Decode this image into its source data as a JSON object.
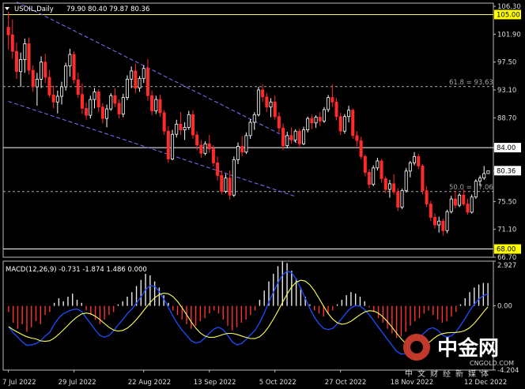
{
  "chart_data": {
    "type": "candlestick",
    "symbol": "USOIL,Daily",
    "header": {
      "symbol_label": "USOIL,Daily",
      "ohlc_text": "79.90 80.40 79.87 80.36"
    },
    "price_axis": {
      "range": [
        66.7,
        106.8
      ],
      "ticks": [
        "106.30",
        "101.90",
        "97.50",
        "93.10",
        "88.70",
        "84.00",
        "80.36",
        "75.50",
        "71.10",
        "66.70"
      ],
      "highlight_labels": [
        {
          "text": "105.00",
          "value": 105.0,
          "bg": "#ffff00"
        },
        {
          "text": "84.00",
          "value": 84.0,
          "bg": "#ffffff"
        },
        {
          "text": "80.36",
          "value": 80.36,
          "bg": "#ffffff"
        },
        {
          "text": "68.00",
          "value": 68.0,
          "bg": "#ffff00"
        }
      ]
    },
    "horizontal_lines": [
      {
        "value": 105.0,
        "color": "#ffff66",
        "style": "solid"
      },
      {
        "value": 84.0,
        "color": "#ffffff",
        "style": "solid"
      },
      {
        "value": 68.0,
        "color": "#ffffff",
        "style": "solid"
      },
      {
        "value": 93.63,
        "color": "#aaaaaa",
        "style": "dash",
        "label": "61.8 = 93.63"
      },
      {
        "value": 77.06,
        "color": "#aaaaaa",
        "style": "dash",
        "label": "50.0 = 77.06"
      }
    ],
    "trend_lines": [
      {
        "from": [
          2,
          107.0
        ],
        "to": [
          71,
          84.6
        ],
        "color": "#8a6bff"
      },
      {
        "from": [
          0,
          91.3
        ],
        "to": [
          70,
          76.3
        ],
        "color": "#8a6bff"
      }
    ],
    "x_labels": [
      "7 Jul 2022",
      "29 Jul 2022",
      "22 Aug 2022",
      "13 Sep 2022",
      "5 Oct 2022",
      "27 Oct 2022",
      "18 Nov 2022",
      "12 Dec 2022"
    ],
    "x_label_index": [
      0,
      16,
      33,
      49,
      65,
      81,
      97,
      115
    ],
    "candles": [
      [
        103.0,
        105.5,
        99.5,
        101.8
      ],
      [
        101.8,
        104.2,
        98.0,
        99.2
      ],
      [
        99.2,
        100.6,
        94.8,
        96.0
      ],
      [
        96.0,
        99.0,
        93.6,
        97.9
      ],
      [
        97.9,
        101.2,
        95.8,
        100.4
      ],
      [
        100.4,
        101.4,
        95.5,
        96.2
      ],
      [
        96.2,
        97.0,
        92.8,
        93.6
      ],
      [
        93.6,
        95.8,
        90.6,
        94.8
      ],
      [
        94.8,
        98.4,
        93.4,
        97.5
      ],
      [
        97.5,
        98.8,
        94.2,
        95.1
      ],
      [
        95.1,
        96.2,
        91.9,
        92.3
      ],
      [
        92.3,
        93.8,
        90.2,
        91.2
      ],
      [
        91.2,
        93.0,
        89.4,
        92.1
      ],
      [
        92.1,
        94.4,
        90.8,
        93.6
      ],
      [
        93.6,
        97.4,
        93.0,
        96.9
      ],
      [
        96.9,
        99.6,
        95.2,
        98.7
      ],
      [
        98.7,
        99.2,
        94.1,
        94.7
      ],
      [
        94.7,
        95.8,
        91.8,
        92.4
      ],
      [
        92.4,
        94.1,
        89.3,
        90.2
      ],
      [
        90.2,
        91.1,
        88.4,
        89.1
      ],
      [
        89.1,
        92.2,
        88.6,
        91.6
      ],
      [
        91.6,
        93.4,
        90.2,
        92.8
      ],
      [
        92.8,
        93.2,
        89.6,
        90.4
      ],
      [
        90.4,
        91.0,
        87.8,
        88.6
      ],
      [
        88.6,
        90.8,
        87.2,
        90.1
      ],
      [
        90.1,
        92.6,
        89.8,
        92.2
      ],
      [
        92.2,
        93.4,
        90.4,
        91.0
      ],
      [
        91.0,
        91.6,
        88.6,
        89.3
      ],
      [
        89.3,
        92.5,
        88.8,
        91.9
      ],
      [
        91.9,
        95.4,
        91.5,
        94.8
      ],
      [
        94.8,
        96.8,
        93.4,
        96.1
      ],
      [
        96.1,
        97.2,
        92.6,
        93.4
      ],
      [
        93.4,
        95.3,
        92.8,
        94.9
      ],
      [
        94.9,
        97.0,
        94.2,
        96.5
      ],
      [
        96.5,
        98.0,
        91.4,
        92.2
      ],
      [
        92.2,
        93.0,
        89.1,
        89.8
      ],
      [
        89.8,
        92.2,
        89.3,
        91.6
      ],
      [
        91.6,
        92.4,
        88.9,
        89.5
      ],
      [
        89.5,
        89.9,
        86.0,
        86.6
      ],
      [
        86.6,
        87.4,
        81.6,
        82.2
      ],
      [
        82.2,
        86.8,
        82.0,
        86.1
      ],
      [
        86.1,
        88.4,
        85.6,
        87.7
      ],
      [
        87.7,
        89.6,
        86.0,
        86.8
      ],
      [
        86.8,
        88.0,
        85.2,
        87.2
      ],
      [
        87.2,
        89.8,
        86.8,
        89.2
      ],
      [
        89.2,
        89.9,
        85.4,
        86.0
      ],
      [
        86.0,
        86.6,
        83.6,
        84.4
      ],
      [
        84.4,
        85.2,
        82.4,
        83.1
      ],
      [
        83.1,
        85.0,
        82.8,
        84.6
      ],
      [
        84.6,
        86.0,
        83.2,
        83.8
      ],
      [
        83.8,
        84.4,
        81.0,
        81.6
      ],
      [
        81.6,
        82.6,
        78.8,
        79.6
      ],
      [
        79.6,
        80.4,
        76.6,
        77.1
      ],
      [
        77.1,
        79.8,
        76.8,
        79.2
      ],
      [
        79.2,
        80.4,
        75.8,
        76.5
      ],
      [
        76.5,
        82.6,
        76.2,
        82.1
      ],
      [
        82.1,
        84.8,
        81.4,
        84.2
      ],
      [
        84.2,
        85.8,
        82.6,
        83.3
      ],
      [
        83.3,
        86.4,
        83.0,
        85.9
      ],
      [
        85.9,
        88.5,
        85.4,
        88.0
      ],
      [
        88.0,
        89.6,
        86.8,
        89.2
      ],
      [
        89.2,
        93.6,
        88.9,
        93.1
      ],
      [
        93.1,
        94.0,
        91.2,
        92.0
      ],
      [
        92.0,
        92.6,
        89.6,
        90.4
      ],
      [
        90.4,
        91.8,
        88.8,
        91.2
      ],
      [
        91.2,
        92.2,
        88.4,
        88.9
      ],
      [
        88.9,
        89.6,
        86.4,
        87.1
      ],
      [
        87.1,
        87.8,
        83.6,
        84.3
      ],
      [
        84.3,
        86.5,
        83.9,
        85.9
      ],
      [
        85.9,
        87.2,
        84.6,
        85.2
      ],
      [
        85.2,
        86.9,
        84.8,
        86.6
      ],
      [
        86.6,
        87.0,
        84.0,
        84.6
      ],
      [
        84.6,
        87.3,
        84.4,
        86.8
      ],
      [
        86.8,
        88.9,
        86.4,
        88.6
      ],
      [
        88.6,
        89.2,
        86.9,
        87.9
      ],
      [
        87.9,
        89.1,
        87.1,
        88.8
      ],
      [
        88.8,
        89.6,
        87.4,
        88.2
      ],
      [
        88.2,
        90.4,
        87.9,
        90.0
      ],
      [
        90.0,
        92.3,
        89.6,
        91.9
      ],
      [
        91.9,
        94.0,
        90.4,
        91.2
      ],
      [
        91.2,
        91.8,
        88.3,
        88.9
      ],
      [
        88.9,
        89.5,
        86.0,
        86.6
      ],
      [
        86.6,
        89.3,
        86.2,
        88.9
      ],
      [
        88.9,
        90.6,
        88.0,
        89.9
      ],
      [
        89.9,
        90.2,
        85.4,
        85.9
      ],
      [
        85.9,
        86.6,
        84.2,
        85.1
      ],
      [
        85.1,
        85.7,
        82.2,
        82.6
      ],
      [
        82.6,
        82.9,
        79.5,
        80.1
      ],
      [
        80.1,
        80.6,
        77.6,
        78.2
      ],
      [
        78.2,
        81.2,
        77.9,
        80.8
      ],
      [
        80.8,
        82.4,
        80.4,
        81.9
      ],
      [
        81.9,
        82.2,
        78.5,
        79.1
      ],
      [
        79.1,
        79.5,
        76.8,
        77.4
      ],
      [
        77.4,
        78.9,
        76.1,
        78.3
      ],
      [
        78.3,
        79.8,
        76.6,
        77.0
      ],
      [
        77.0,
        77.6,
        74.0,
        74.6
      ],
      [
        74.6,
        77.5,
        74.3,
        77.2
      ],
      [
        77.2,
        80.8,
        76.9,
        80.3
      ],
      [
        80.3,
        81.9,
        79.3,
        81.6
      ],
      [
        81.6,
        83.3,
        81.2,
        82.6
      ],
      [
        82.6,
        83.0,
        80.6,
        81.1
      ],
      [
        81.1,
        81.4,
        76.6,
        77.2
      ],
      [
        77.2,
        77.9,
        74.6,
        75.1
      ],
      [
        75.1,
        75.6,
        72.4,
        73.0
      ],
      [
        73.0,
        73.6,
        71.2,
        71.8
      ],
      [
        71.8,
        73.1,
        70.6,
        72.4
      ],
      [
        72.4,
        72.8,
        70.1,
        70.9
      ],
      [
        70.9,
        74.2,
        70.5,
        73.9
      ],
      [
        73.9,
        76.4,
        73.6,
        75.9
      ],
      [
        75.9,
        77.2,
        74.4,
        74.9
      ],
      [
        74.9,
        76.8,
        74.6,
        76.5
      ],
      [
        76.5,
        77.4,
        74.8,
        75.1
      ],
      [
        75.1,
        75.9,
        73.4,
        73.8
      ],
      [
        73.8,
        76.6,
        73.6,
        76.2
      ],
      [
        76.2,
        79.0,
        75.9,
        78.7
      ],
      [
        78.7,
        79.6,
        77.9,
        79.2
      ],
      [
        79.2,
        81.1,
        78.9,
        79.9
      ],
      [
        79.9,
        80.4,
        79.87,
        80.36
      ]
    ],
    "macd": {
      "label": "MACD(12,26,9) -0.731 -1.874 1.486 0.000",
      "params": "12,26,9",
      "values": [
        -0.731,
        -1.874,
        1.486,
        0.0
      ],
      "axis_ticks": [
        "2.927",
        "0.00",
        "-4.204"
      ],
      "range": [
        -4.204,
        2.927
      ],
      "histogram": [
        -0.4,
        -1.1,
        -1.5,
        -1.2,
        -1.7,
        -1.4,
        -1.0,
        -1.2,
        -0.6,
        -0.4,
        0.2,
        0.5,
        0.3,
        0.6,
        0.8,
        0.4,
        0.2,
        -0.3,
        -0.6,
        -0.9,
        -1.2,
        -0.9,
        -0.6,
        -0.4,
        0.1,
        0.3,
        0.6,
        0.9,
        1.3,
        1.7,
        2.1,
        2.0,
        1.6,
        1.2,
        0.7,
        0.2,
        -0.3,
        -0.6,
        -0.9,
        -1.2,
        -1.5,
        -1.3,
        -1.0,
        -0.8,
        -0.5,
        -0.3,
        -0.5,
        -0.9,
        -1.3,
        -1.6,
        -1.4,
        -1.1,
        -0.9,
        -0.6,
        -0.3,
        0.4,
        1.0,
        1.6,
        2.1,
        2.6,
        2.9,
        2.8,
        2.3,
        1.8,
        1.2,
        0.6,
        0.1,
        -0.3,
        -0.5,
        -0.7,
        -0.5,
        -0.3,
        0.1,
        0.4,
        0.7,
        0.9,
        0.8,
        0.6,
        0.3,
        -0.1,
        -0.4,
        -0.8,
        -1.1,
        -1.5,
        -1.8,
        -2.1,
        -2.0,
        -1.7,
        -1.3,
        -1.0,
        -0.8,
        -0.5,
        -0.3,
        -0.6,
        -0.9,
        -1.1,
        -1.0,
        -0.7,
        -0.4,
        0.1,
        0.5,
        0.9,
        1.2,
        1.4,
        1.5,
        1.49
      ]
    }
  },
  "watermark": {
    "brand": "中金网",
    "domain": "CNGOLD.COM",
    "tagline": "中文财经新媒体"
  }
}
